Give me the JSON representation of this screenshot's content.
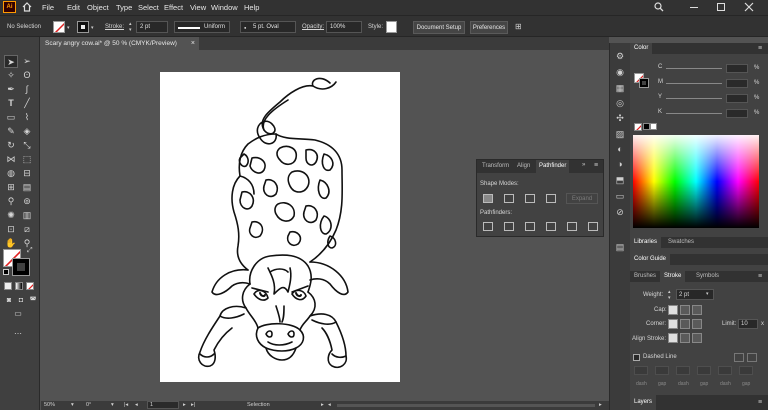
{
  "app": {
    "logo": "Ai"
  },
  "menu": [
    "File",
    "Edit",
    "Object",
    "Type",
    "Select",
    "Effect",
    "View",
    "Window",
    "Help"
  ],
  "control_bar": {
    "selection": "No Selection",
    "stroke_label": "Stroke:",
    "stroke_value": "2 pt",
    "profile": "Uniform",
    "brush": "5 pt. Oval",
    "opacity_label": "Opacity:",
    "opacity_value": "100%",
    "style_label": "Style:",
    "document_setup": "Document Setup",
    "preferences": "Preferences"
  },
  "document": {
    "tab_title": "Scary angry cow.ai* @ 50 % (CMYK/Preview)"
  },
  "status": {
    "zoom": "50%",
    "rotation": "0°",
    "artboard": "1",
    "tool": "Selection"
  },
  "color_panel": {
    "title": "Color",
    "channels": [
      {
        "label": "C",
        "unit": "%"
      },
      {
        "label": "M",
        "unit": "%"
      },
      {
        "label": "Y",
        "unit": "%"
      },
      {
        "label": "K",
        "unit": "%"
      }
    ]
  },
  "panel_tabs": {
    "libraries": "Libraries",
    "swatches": "Swatches",
    "color_guide": "Color Guide",
    "brushes": "Brushes",
    "stroke": "Stroke",
    "symbols": "Symbols",
    "layers": "Layers"
  },
  "stroke_panel": {
    "weight_label": "Weight:",
    "weight_value": "2 pt",
    "cap_label": "Cap:",
    "corner_label": "Corner:",
    "limit_label": "Limit:",
    "limit_value": "10",
    "limit_unit": "x",
    "align_label": "Align Stroke:",
    "dashed_line": "Dashed Line",
    "dash_labels": [
      "dash",
      "gap",
      "dash",
      "gap",
      "dash",
      "gap"
    ]
  },
  "pathfinder": {
    "tabs": [
      "Transform",
      "Align",
      "Pathfinder"
    ],
    "shape_modes": "Shape Modes:",
    "expand": "Expand",
    "pathfinders": "Pathfinders:"
  }
}
